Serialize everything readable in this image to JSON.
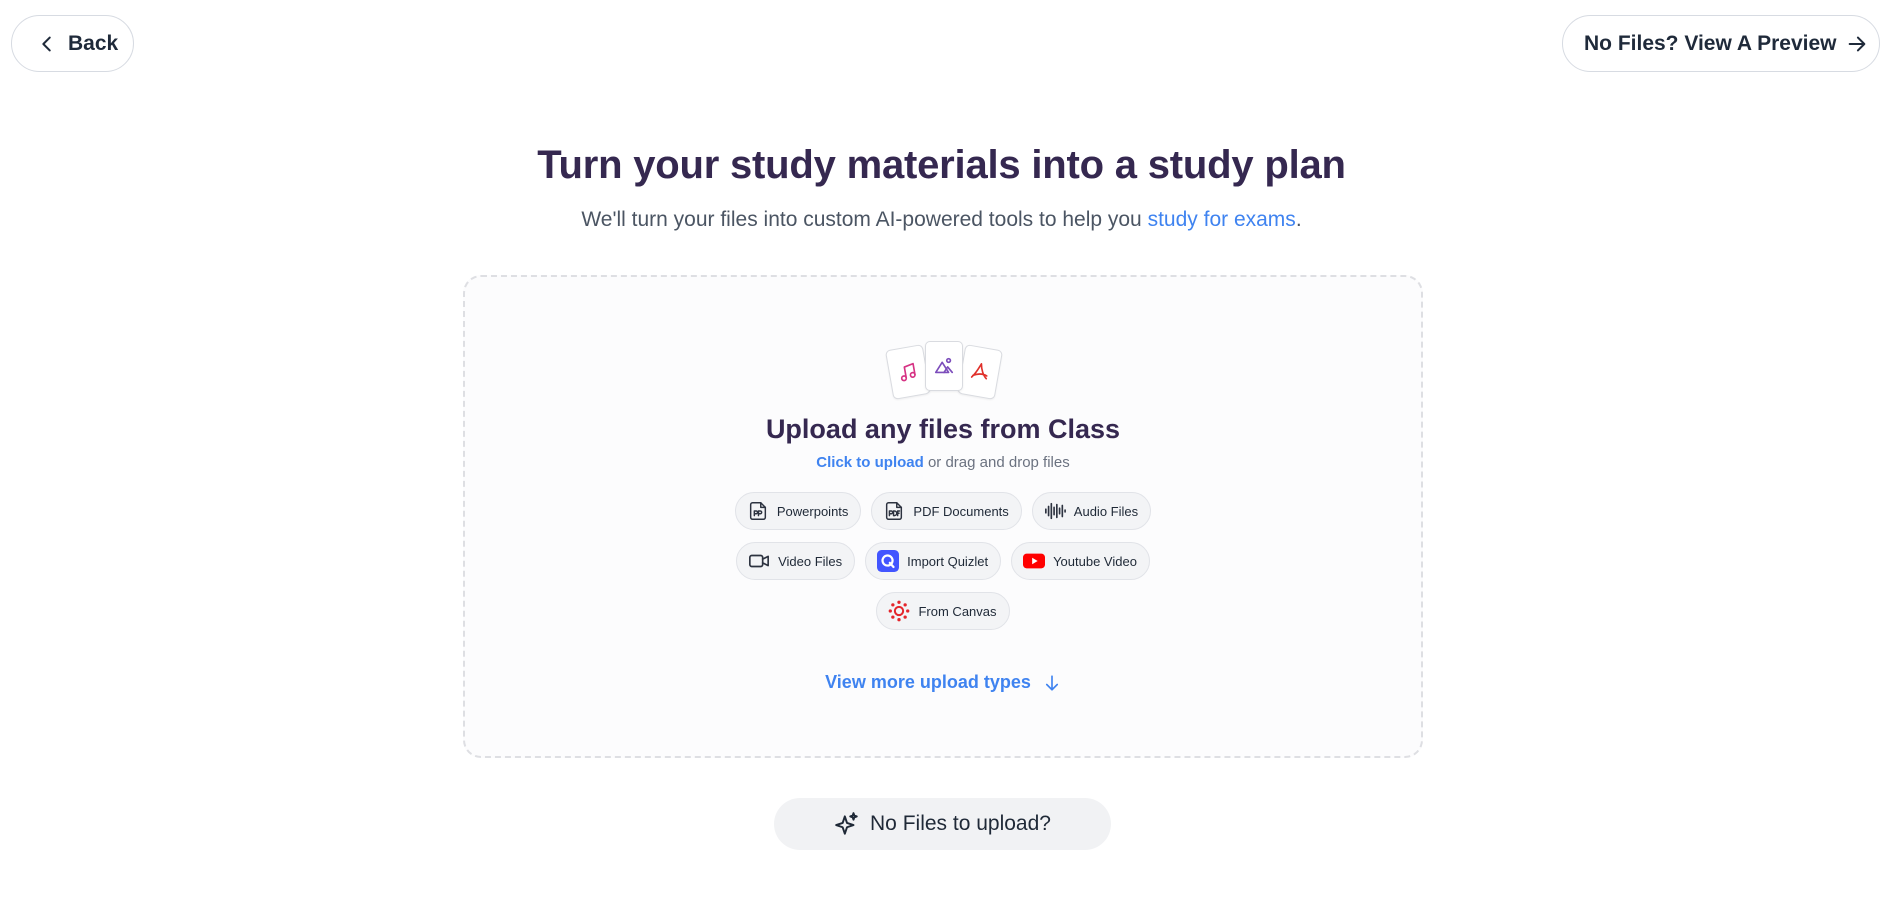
{
  "nav": {
    "back_label": "Back",
    "preview_label": "No Files? View A Preview"
  },
  "hero": {
    "title": "Turn your study materials into a study plan",
    "subtitle_prefix": "We'll turn your files into custom AI-powered tools to help you ",
    "subtitle_link": "study for exams",
    "subtitle_suffix": "."
  },
  "dropzone": {
    "file_icons": [
      "music-note-icon",
      "image-icon",
      "pdf-icon"
    ],
    "title": "Upload any files from Class",
    "click_label": "Click to upload",
    "hint_suffix": " or drag and drop files",
    "chips_row1": [
      {
        "label": "Powerpoints",
        "icon": "powerpoint-icon"
      },
      {
        "label": "PDF Documents",
        "icon": "pdf-document-icon"
      },
      {
        "label": "Audio Files",
        "icon": "audio-waveform-icon"
      }
    ],
    "chips_row2": [
      {
        "label": "Video Files",
        "icon": "video-camera-icon"
      },
      {
        "label": "Import Quizlet",
        "icon": "quizlet-icon"
      },
      {
        "label": "Youtube Video",
        "icon": "youtube-icon"
      }
    ],
    "chips_row3": [
      {
        "label": "From Canvas",
        "icon": "canvas-icon"
      }
    ],
    "view_more_label": "View more upload types"
  },
  "footer": {
    "no_files_label": "No Files to upload?"
  },
  "colors": {
    "accent_blue": "#3f83f0",
    "title_purple": "#352850",
    "youtube_red": "#ff0000",
    "quizlet_indigo": "#4255ff",
    "canvas_red": "#e4252b"
  }
}
